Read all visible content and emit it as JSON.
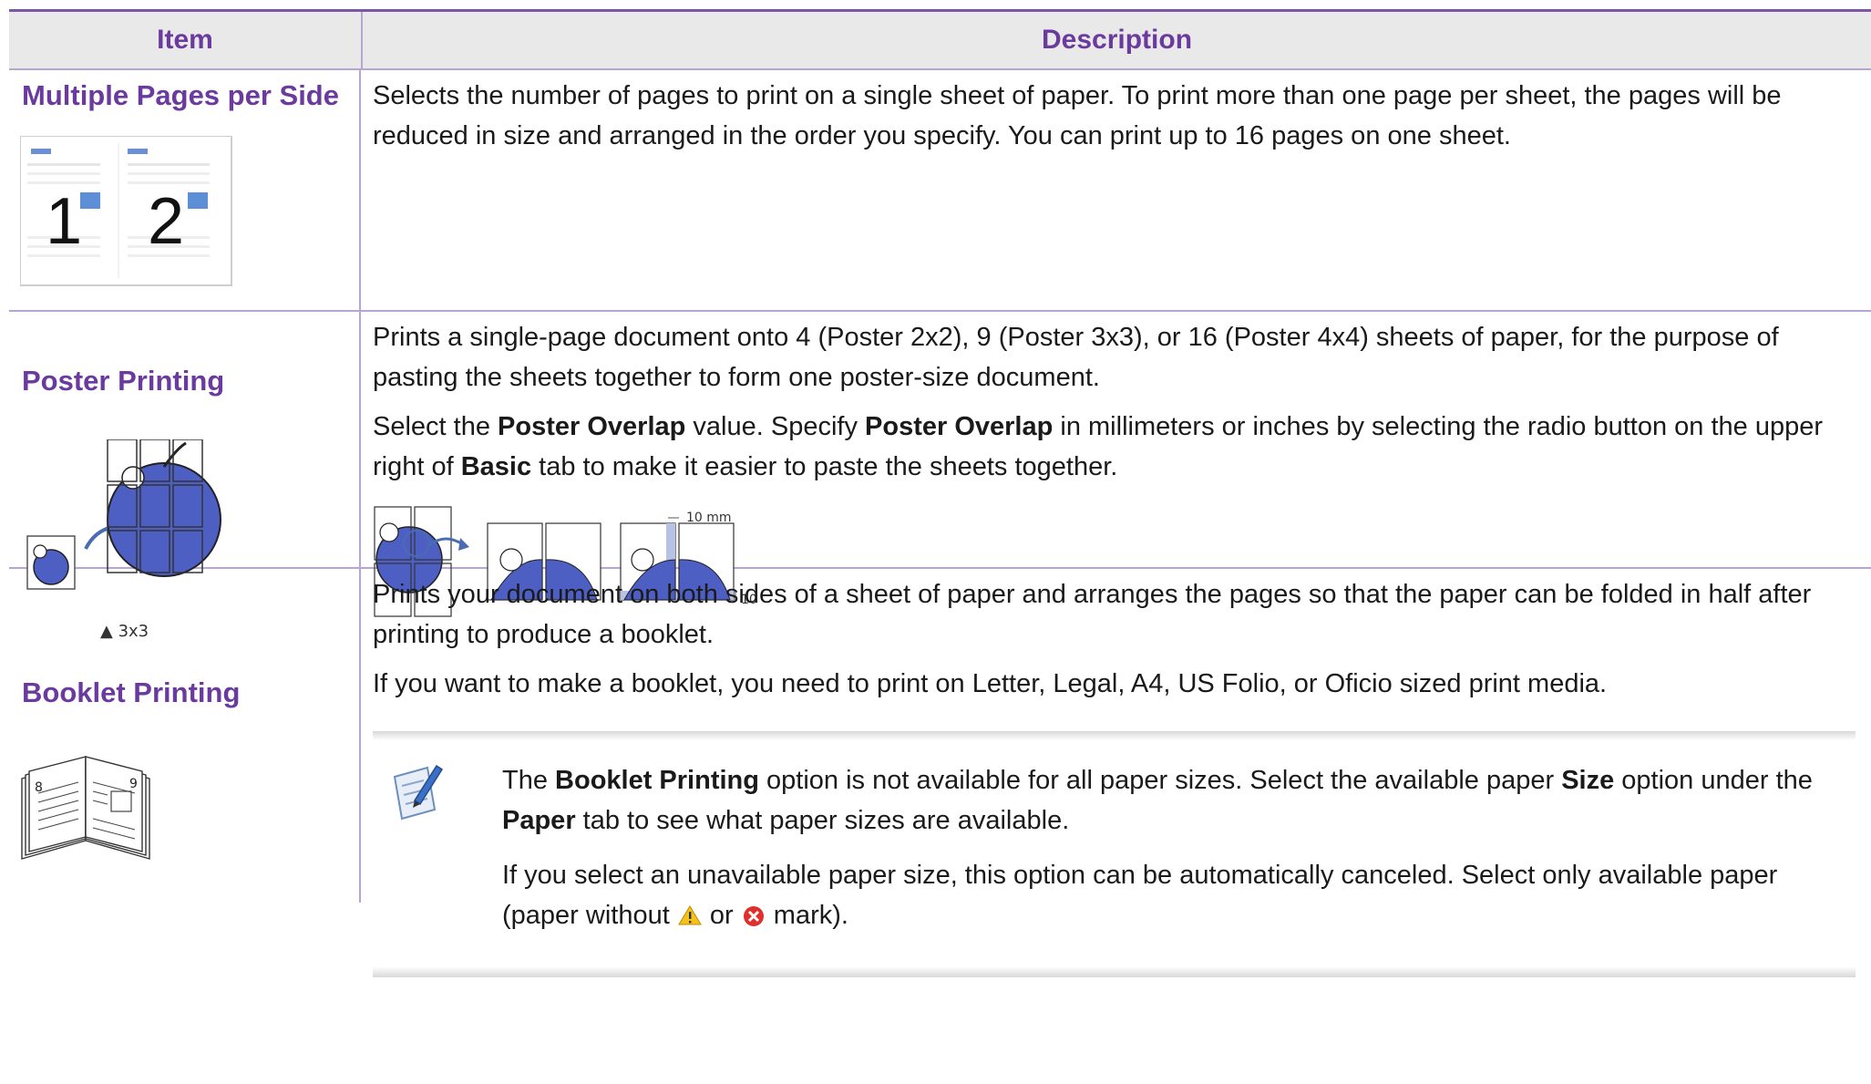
{
  "header": {
    "item": "Item",
    "description": "Description"
  },
  "rows": [
    {
      "item": "Multiple Pages per Side",
      "desc_p1": "Selects the number of pages to print on a single sheet of paper. To print more than one page per sheet, the pages will be reduced in size and arranged in the order you specify. You can print up to 16 pages on one sheet.",
      "thumb_labels": [
        "1",
        "2"
      ]
    },
    {
      "item": "Poster Printing",
      "desc_p1": "Prints a single-page document onto 4 (Poster 2x2), 9 (Poster 3x3), or 16 (Poster 4x4) sheets of paper, for the purpose of pasting the sheets together to form one poster-size document.",
      "desc_p2_pre": "Select the ",
      "desc_p2_b1": "Poster Overlap",
      "desc_p2_mid1": " value. Specify ",
      "desc_p2_b2": "Poster Overlap",
      "desc_p2_mid2": " in millimeters or inches by selecting the radio button on the upper right of ",
      "desc_p2_b3": "Basic",
      "desc_p2_post": " tab to make it easier to paste the sheets together.",
      "caption": "▲ 3x3",
      "overlap_top": "10 mm",
      "overlap_right": "10 mm"
    },
    {
      "item": "Booklet Printing",
      "desc_p1": "Prints your document on both sides of a sheet of paper and arranges the pages so that the paper can be folded in half after printing to produce a booklet.",
      "desc_p2": "If you want to make a booklet, you need to print on Letter, Legal, A4, US Folio, or Oficio sized print media.",
      "booklet_pages": [
        "8",
        "9"
      ],
      "note": {
        "p1_pre": "The ",
        "p1_b1": "Booklet Printing",
        "p1_mid1": " option is not available for all paper sizes. Select the available paper ",
        "p1_b2": "Size",
        "p1_mid2": " option under the ",
        "p1_b3": "Paper",
        "p1_post": " tab to see what paper sizes are available.",
        "p2_pre": "If you select an unavailable paper size, this option can be automatically canceled. Select only available paper (paper without ",
        "p2_or": " or ",
        "p2_post": " mark)."
      }
    }
  ],
  "colors": {
    "accent": "#6a3a9e",
    "rule": "#b7a6cf",
    "apple": "#4e5fc4"
  }
}
